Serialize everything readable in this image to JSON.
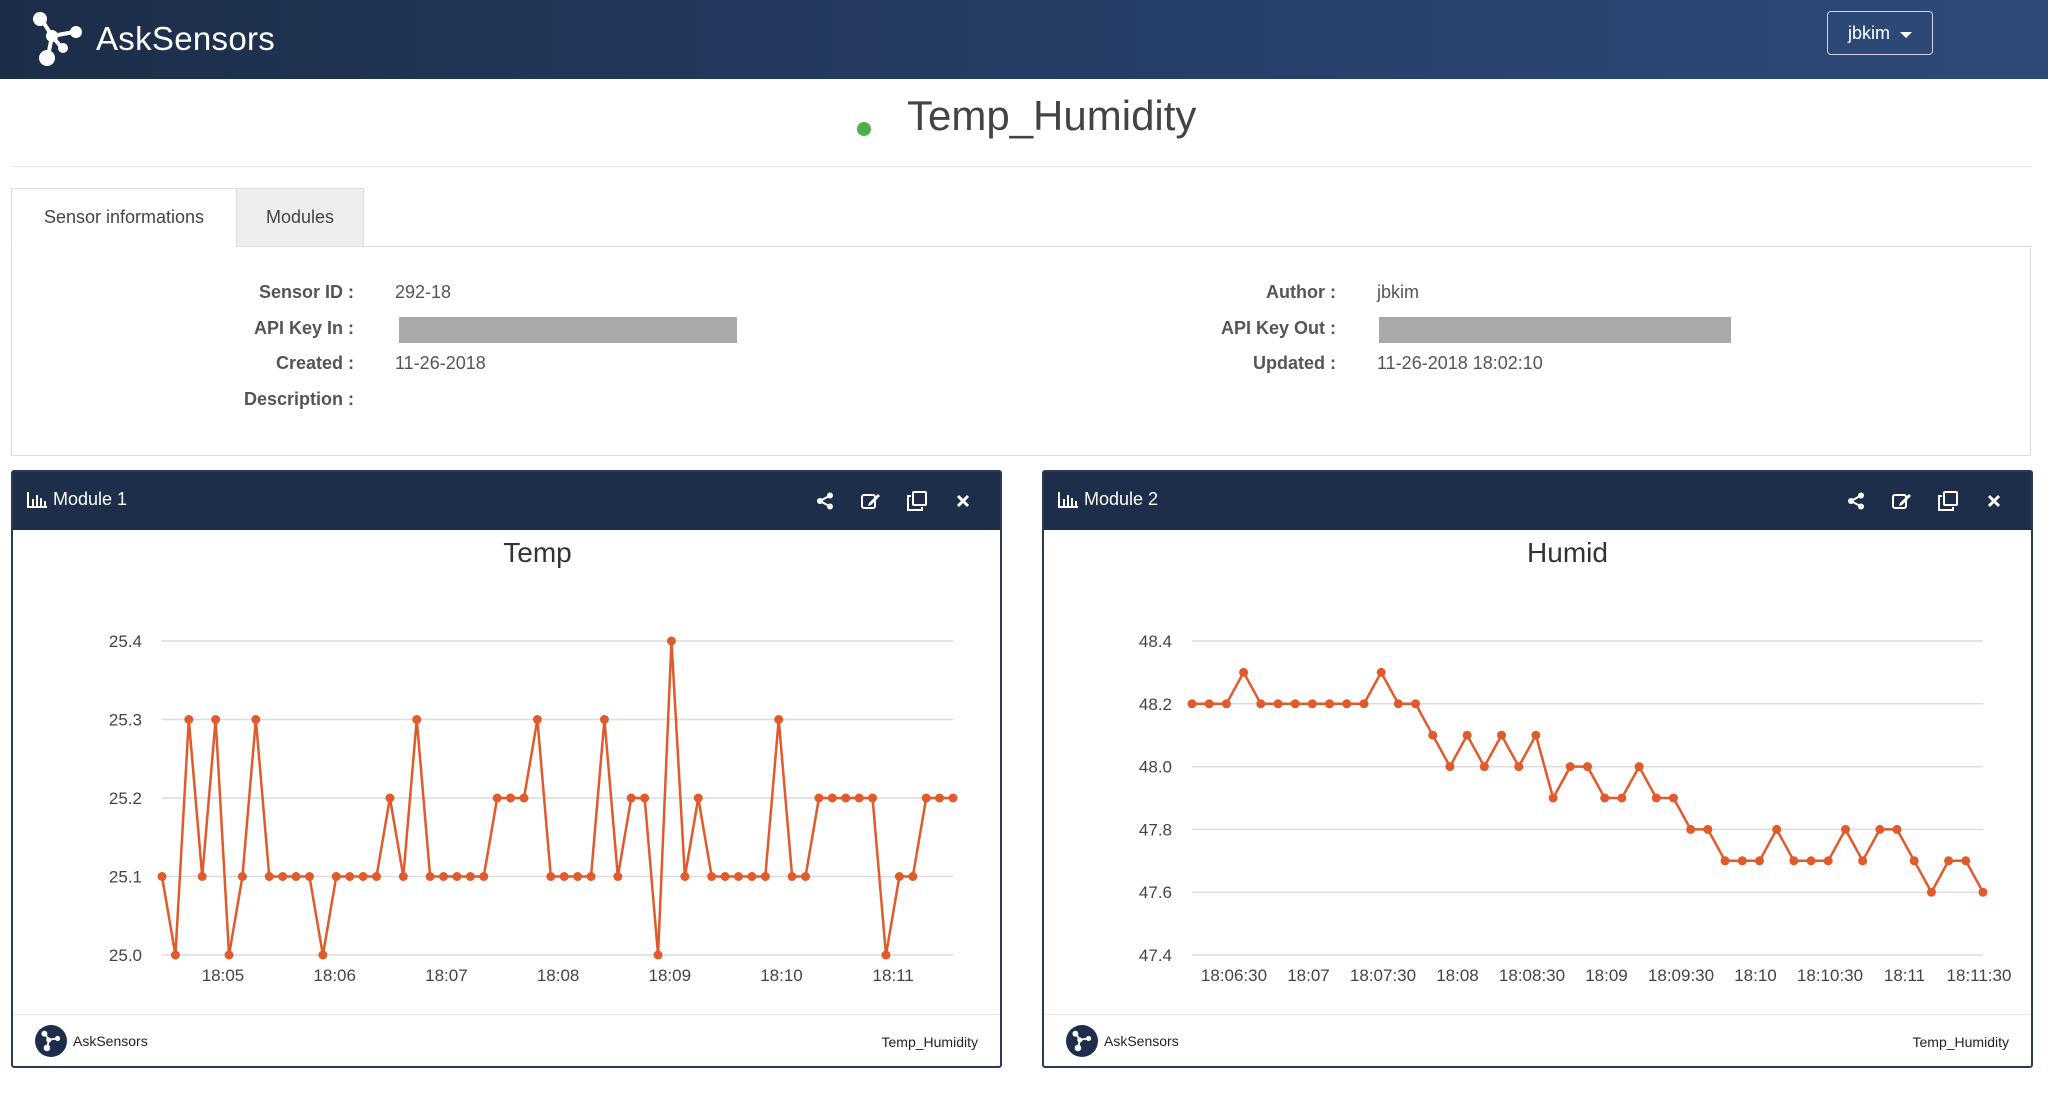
{
  "app": {
    "brand": "AskSensors",
    "user": "jbkim"
  },
  "sensor": {
    "name": "Temp_Humidity",
    "status_color": "#4cae4c"
  },
  "tabs": [
    {
      "label": "Sensor informations",
      "active": true
    },
    {
      "label": "Modules",
      "active": false
    }
  ],
  "info": {
    "sensor_id_label": "Sensor ID :",
    "sensor_id": "292-18",
    "api_key_in_label": "API Key In :",
    "created_label": "Created :",
    "created": "11-26-2018",
    "description_label": "Description :",
    "author_label": "Author :",
    "author": "jbkim",
    "api_key_out_label": "API Key Out :",
    "updated_label": "Updated :",
    "updated": "11-26-2018 18:02:10"
  },
  "modules": [
    {
      "title": "Module 1",
      "footer_brand": "AskSensors",
      "footer_sensor": "Temp_Humidity"
    },
    {
      "title": "Module 2",
      "footer_brand": "AskSensors",
      "footer_sensor": "Temp_Humidity"
    }
  ],
  "colors": {
    "navbar": "#1e2e4a",
    "line": "#e05a2b"
  },
  "chart_data": [
    {
      "type": "line",
      "title": "Temp",
      "xlabel": "",
      "ylabel": "",
      "ylim": [
        25.0,
        25.4
      ],
      "yticks": [
        "25.0",
        "25.1",
        "25.2",
        "25.3",
        "25.4"
      ],
      "xticks": [
        "18:05",
        "18:06",
        "18:07",
        "18:08",
        "18:09",
        "18:10",
        "18:11"
      ],
      "grid": true,
      "series": [
        {
          "values": [
            25.1,
            25.0,
            25.3,
            25.1,
            25.3,
            25.0,
            25.1,
            25.3,
            25.1,
            25.1,
            25.1,
            25.1,
            25.0,
            25.1,
            25.1,
            25.1,
            25.1,
            25.2,
            25.1,
            25.3,
            25.1,
            25.1,
            25.1,
            25.1,
            25.1,
            25.2,
            25.2,
            25.2,
            25.3,
            25.1,
            25.1,
            25.1,
            25.1,
            25.3,
            25.1,
            25.2,
            25.2,
            25.0,
            25.4,
            25.1,
            25.2,
            25.1,
            25.1,
            25.1,
            25.1,
            25.1,
            25.3,
            25.1,
            25.1,
            25.2,
            25.2,
            25.2,
            25.2,
            25.2,
            25.0,
            25.1,
            25.1,
            25.2,
            25.2,
            25.2
          ]
        }
      ]
    },
    {
      "type": "line",
      "title": "Humid",
      "xlabel": "",
      "ylabel": "",
      "ylim": [
        47.4,
        48.4
      ],
      "yticks": [
        "47.4",
        "47.6",
        "47.8",
        "48.0",
        "48.2",
        "48.4"
      ],
      "xticks": [
        "18:06:30",
        "18:07",
        "18:07:30",
        "18:08",
        "18:08:30",
        "18:09",
        "18:09:30",
        "18:10",
        "18:10:30",
        "18:11",
        "18:11:30"
      ],
      "grid": true,
      "series": [
        {
          "values": [
            48.2,
            48.2,
            48.2,
            48.3,
            48.2,
            48.2,
            48.2,
            48.2,
            48.2,
            48.2,
            48.2,
            48.3,
            48.2,
            48.2,
            48.1,
            48.0,
            48.1,
            48.0,
            48.1,
            48.0,
            48.1,
            47.9,
            48.0,
            48.0,
            47.9,
            47.9,
            48.0,
            47.9,
            47.9,
            47.8,
            47.8,
            47.7,
            47.7,
            47.7,
            47.8,
            47.7,
            47.7,
            47.7,
            47.8,
            47.7,
            47.8,
            47.8,
            47.7,
            47.6,
            47.7,
            47.7,
            47.6
          ]
        }
      ]
    }
  ]
}
